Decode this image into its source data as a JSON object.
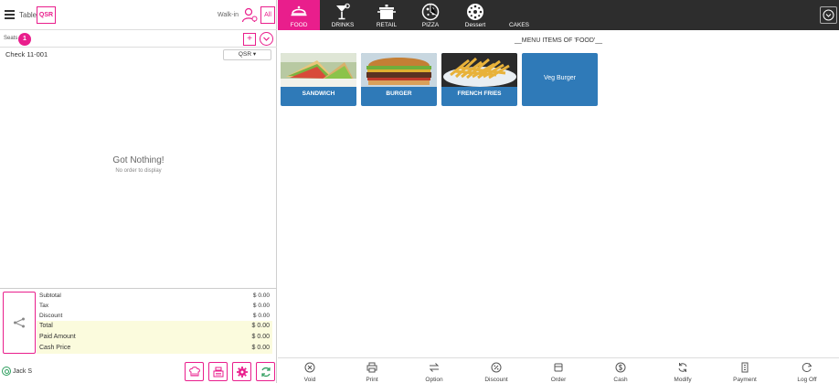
{
  "header": {
    "table_label": "Table",
    "qsr_label": "QSR",
    "walkin_label": "Walk-in",
    "all_label": "All"
  },
  "seats": {
    "label": "Seats",
    "count": "1",
    "add": "+"
  },
  "check": {
    "label": "Check 11-001",
    "order_type": "QSR ▾"
  },
  "empty": {
    "title": "Got Nothing!",
    "subtitle": "No order to display"
  },
  "totals": {
    "rows": [
      {
        "label": "Subtotal",
        "value": "$ 0.00"
      },
      {
        "label": "Tax",
        "value": "$ 0.00"
      },
      {
        "label": "Discount",
        "value": "$ 0.00"
      },
      {
        "label": "Total",
        "value": "$ 0.00"
      },
      {
        "label": "Paid Amount",
        "value": "$ 0.00"
      },
      {
        "label": "Cash Price",
        "value": "$ 0.00"
      }
    ]
  },
  "user": {
    "name": "Jack S"
  },
  "categories": [
    {
      "label": "FOOD",
      "icon": "food-cover-icon",
      "active": true
    },
    {
      "label": "DRINKS",
      "icon": "cocktail-icon"
    },
    {
      "label": "RETAIL",
      "icon": "pot-icon"
    },
    {
      "label": "PIZZA",
      "icon": "pizza-icon"
    },
    {
      "label": "Dessert",
      "icon": "dessert-icon"
    },
    {
      "label": "CAKES",
      "icon": ""
    }
  ],
  "menu": {
    "title": "__MENU ITEMS OF 'FOOD'__",
    "items": [
      {
        "label": "SANDWICH",
        "icon": "sandwich-image"
      },
      {
        "label": "BURGER",
        "icon": "burger-image"
      },
      {
        "label": "FRENCH FRIES",
        "icon": "fries-image"
      },
      {
        "label": "Veg Burger",
        "icon": ""
      }
    ]
  },
  "actions": [
    {
      "label": "Void",
      "icon": "void-icon"
    },
    {
      "label": "Print",
      "icon": "print-icon"
    },
    {
      "label": "Option",
      "icon": "swap-icon"
    },
    {
      "label": "Discount",
      "icon": "discount-icon"
    },
    {
      "label": "Order",
      "icon": "order-icon"
    },
    {
      "label": "Cash",
      "icon": "cash-icon"
    },
    {
      "label": "Modify",
      "icon": "modify-icon"
    },
    {
      "label": "Payment",
      "icon": "payment-icon"
    },
    {
      "label": "Log Off",
      "icon": "logoff-icon"
    }
  ],
  "colors": {
    "accent": "#e91e8c",
    "topbar": "#2d2d2d",
    "tile": "#2f7ab8",
    "highlight": "#fbfbdd"
  }
}
